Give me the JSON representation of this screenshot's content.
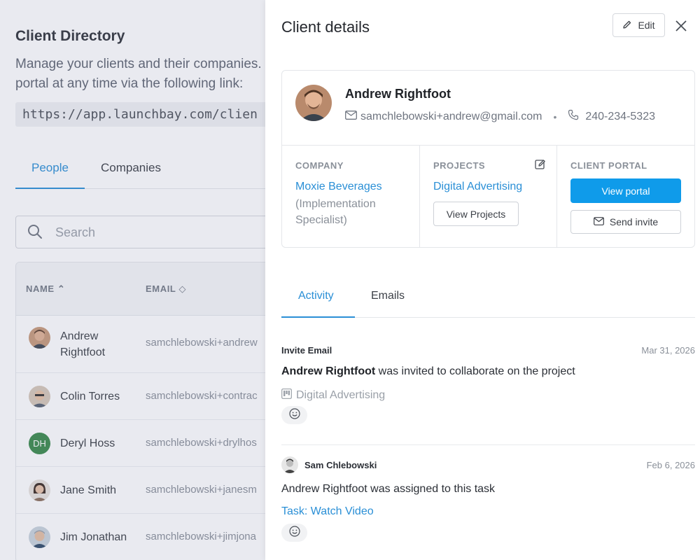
{
  "directory": {
    "title": "Client Directory",
    "description_line1": "Manage your clients and their companies. T",
    "description_line2": "portal at any time via the following link:",
    "link": "https://app.launchbay.com/clien",
    "tabs": [
      "People",
      "Companies"
    ],
    "search_placeholder": "Search",
    "columns": {
      "name": "NAME",
      "email": "EMAIL"
    },
    "rows": [
      {
        "name": "Andrew Rightfoot",
        "email": "samchlebowski+andrew"
      },
      {
        "name": "Colin Torres",
        "email": "samchlebowski+contrac"
      },
      {
        "initials": "DH",
        "name": "Deryl Hoss",
        "email": "samchlebowski+drylhos"
      },
      {
        "name": "Jane Smith",
        "email": "samchlebowski+janesm"
      },
      {
        "name": "Jim Jonathan",
        "email": "samchlebowski+jimjona"
      }
    ]
  },
  "drawer": {
    "title": "Client details",
    "edit_label": "Edit",
    "client": {
      "name": "Andrew Rightfoot",
      "email": "samchlebowski+andrew@gmail.com",
      "phone": "240-234-5323"
    },
    "company": {
      "label": "COMPANY",
      "name": "Moxie Beverages",
      "role": "(Implementation Specialist)"
    },
    "projects": {
      "label": "PROJECTS",
      "name": "Digital Advertising",
      "button": "View Projects"
    },
    "portal": {
      "label": "CLIENT PORTAL",
      "view_button": "View portal",
      "invite_button": "Send invite"
    },
    "tabs": [
      "Activity",
      "Emails"
    ],
    "activities": [
      {
        "heading": "Invite Email",
        "date": "Mar 31, 2026",
        "actor": "Andrew Rightfoot",
        "text": " was invited to collaborate on the project",
        "project": "Digital Advertising"
      },
      {
        "heading": "Sam Chlebowski",
        "date": "Feb 6, 2026",
        "text": "Andrew Rightfoot was assigned to this task",
        "task": "Task: Watch Video"
      }
    ]
  },
  "colors": {
    "accent": "#2a8fd6",
    "primary_button": "#0f9bea",
    "avatar_dh": "#3a8a4a"
  }
}
